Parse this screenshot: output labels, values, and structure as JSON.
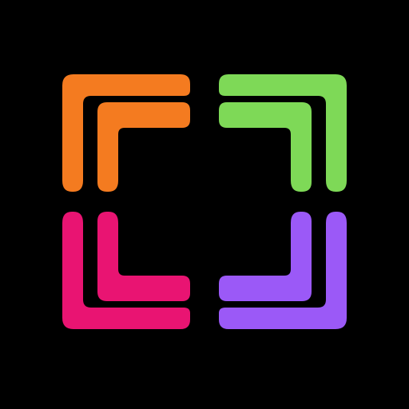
{
  "logo": {
    "name": "four-corner-bracket-logo",
    "background": "#000000",
    "corners": {
      "top_left": {
        "color": "#F47B20",
        "icon": "corner-top-left-icon"
      },
      "top_right": {
        "color": "#7ED957",
        "icon": "corner-top-right-icon"
      },
      "bottom_left": {
        "color": "#E91472",
        "icon": "corner-bottom-left-icon"
      },
      "bottom_right": {
        "color": "#9B59F7",
        "icon": "corner-bottom-right-icon"
      }
    }
  }
}
